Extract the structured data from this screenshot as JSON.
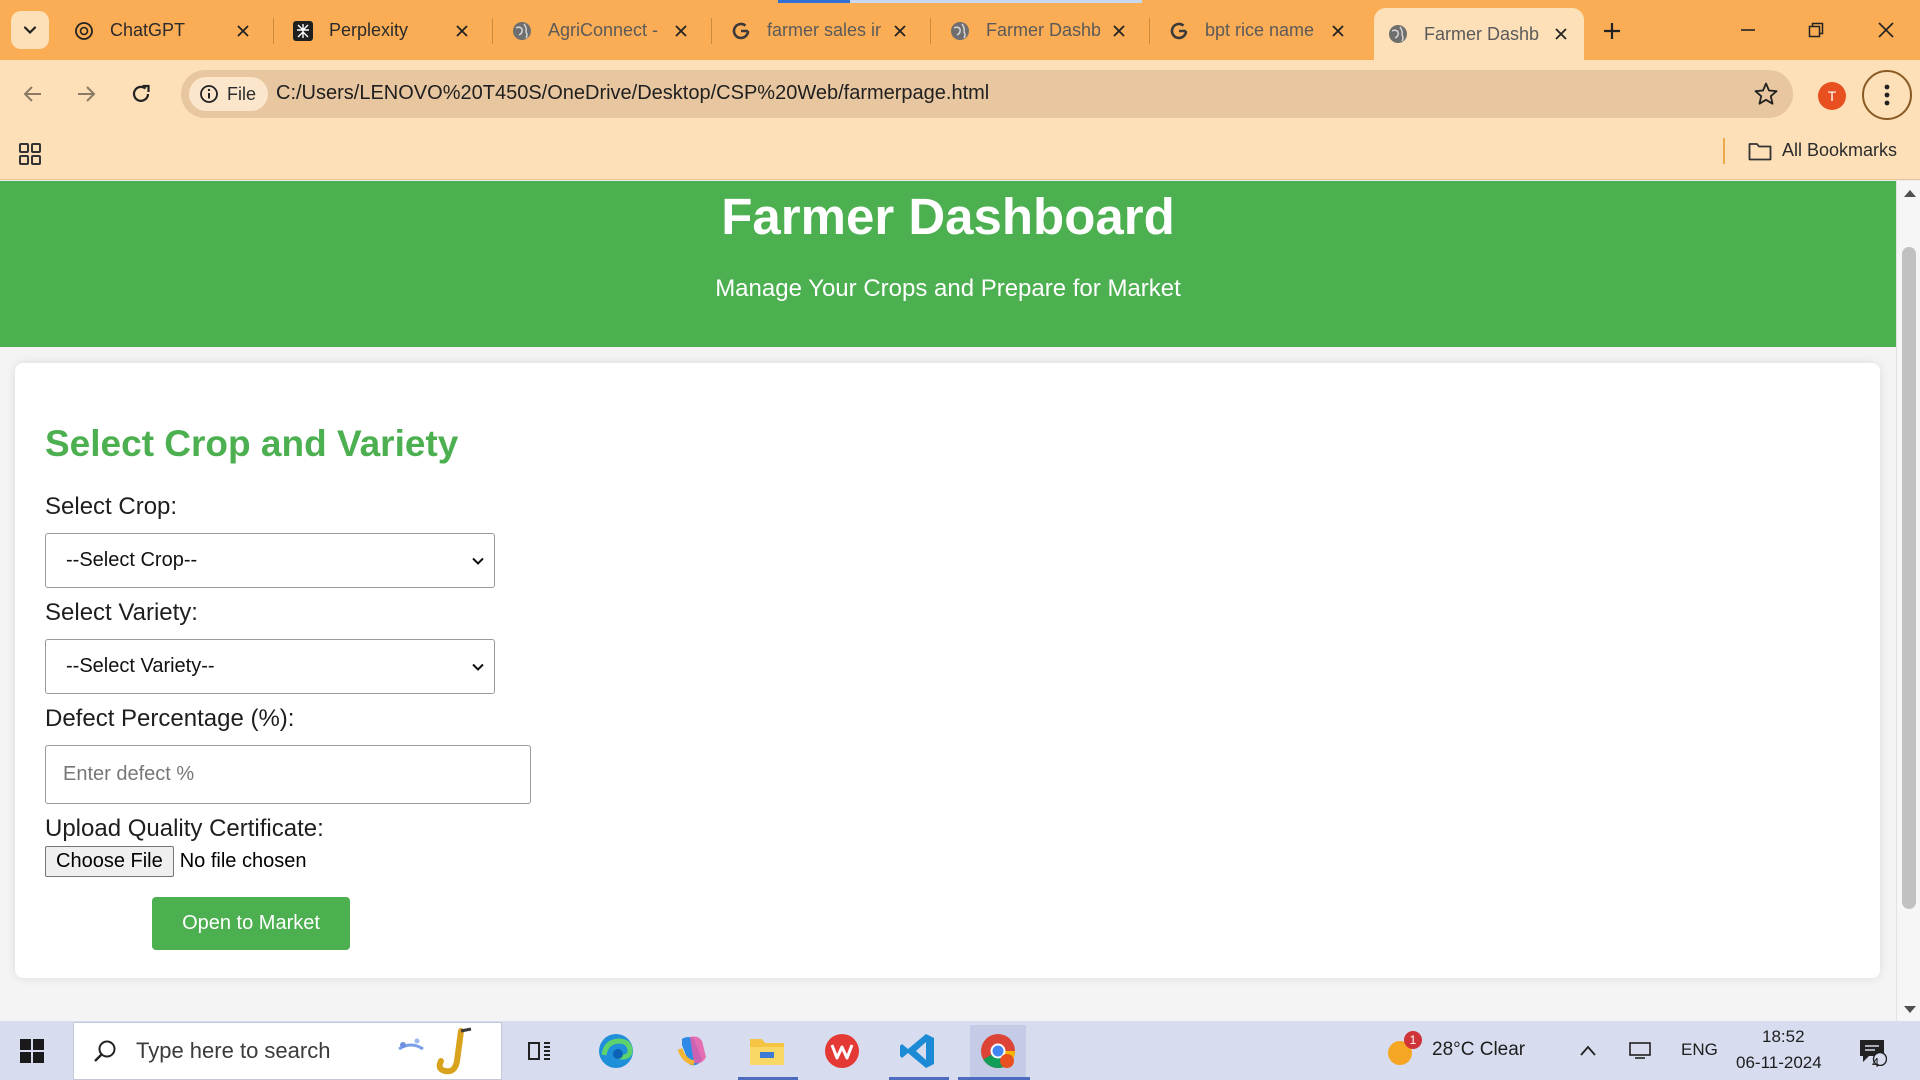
{
  "browser": {
    "tabs": [
      {
        "title": "ChatGPT",
        "icon": "chatgpt-icon"
      },
      {
        "title": "Perplexity",
        "icon": "perplexity-icon"
      },
      {
        "title": "AgriConnect -",
        "icon": "globe-icon"
      },
      {
        "title": "farmer sales in",
        "icon": "google-icon"
      },
      {
        "title": "Farmer Dashb",
        "icon": "globe-icon"
      },
      {
        "title": "bpt rice name",
        "icon": "google-icon"
      },
      {
        "title": "Farmer Dashb",
        "icon": "globe-icon",
        "active": true
      }
    ],
    "file_chip": "File",
    "url": "C:/Users/LENOVO%20T450S/OneDrive/Desktop/CSP%20Web/farmerpage.html",
    "avatar_letter": "T",
    "bookmarks_label": "All Bookmarks",
    "colors": {
      "tabbar": "#fbad55",
      "toolbar": "#fde0b8"
    }
  },
  "page": {
    "header": {
      "title": "Farmer Dashboard",
      "subtitle": "Manage Your Crops and Prepare for Market"
    },
    "form": {
      "heading": "Select Crop and Variety",
      "crop_label": "Select Crop:",
      "crop_selected": "--Select Crop--",
      "variety_label": "Select Variety:",
      "variety_selected": "--Select Variety--",
      "defect_label": "Defect Percentage (%):",
      "defect_placeholder": "Enter defect %",
      "upload_label": "Upload Quality Certificate:",
      "choose_file": "Choose File",
      "no_file": "No file chosen",
      "submit": "Open to Market"
    },
    "colors": {
      "accent": "#4caf50"
    }
  },
  "taskbar": {
    "search_placeholder": "Type here to search",
    "apps": [
      "task-view-icon",
      "edge-icon",
      "copilot-icon",
      "file-explorer-icon",
      "wps-office-icon",
      "vscode-icon",
      "chrome-icon"
    ],
    "weather": {
      "badge": "1",
      "text": "28°C  Clear"
    },
    "language": "ENG",
    "time": "18:52",
    "date": "06-11-2024",
    "notifications": "4"
  }
}
